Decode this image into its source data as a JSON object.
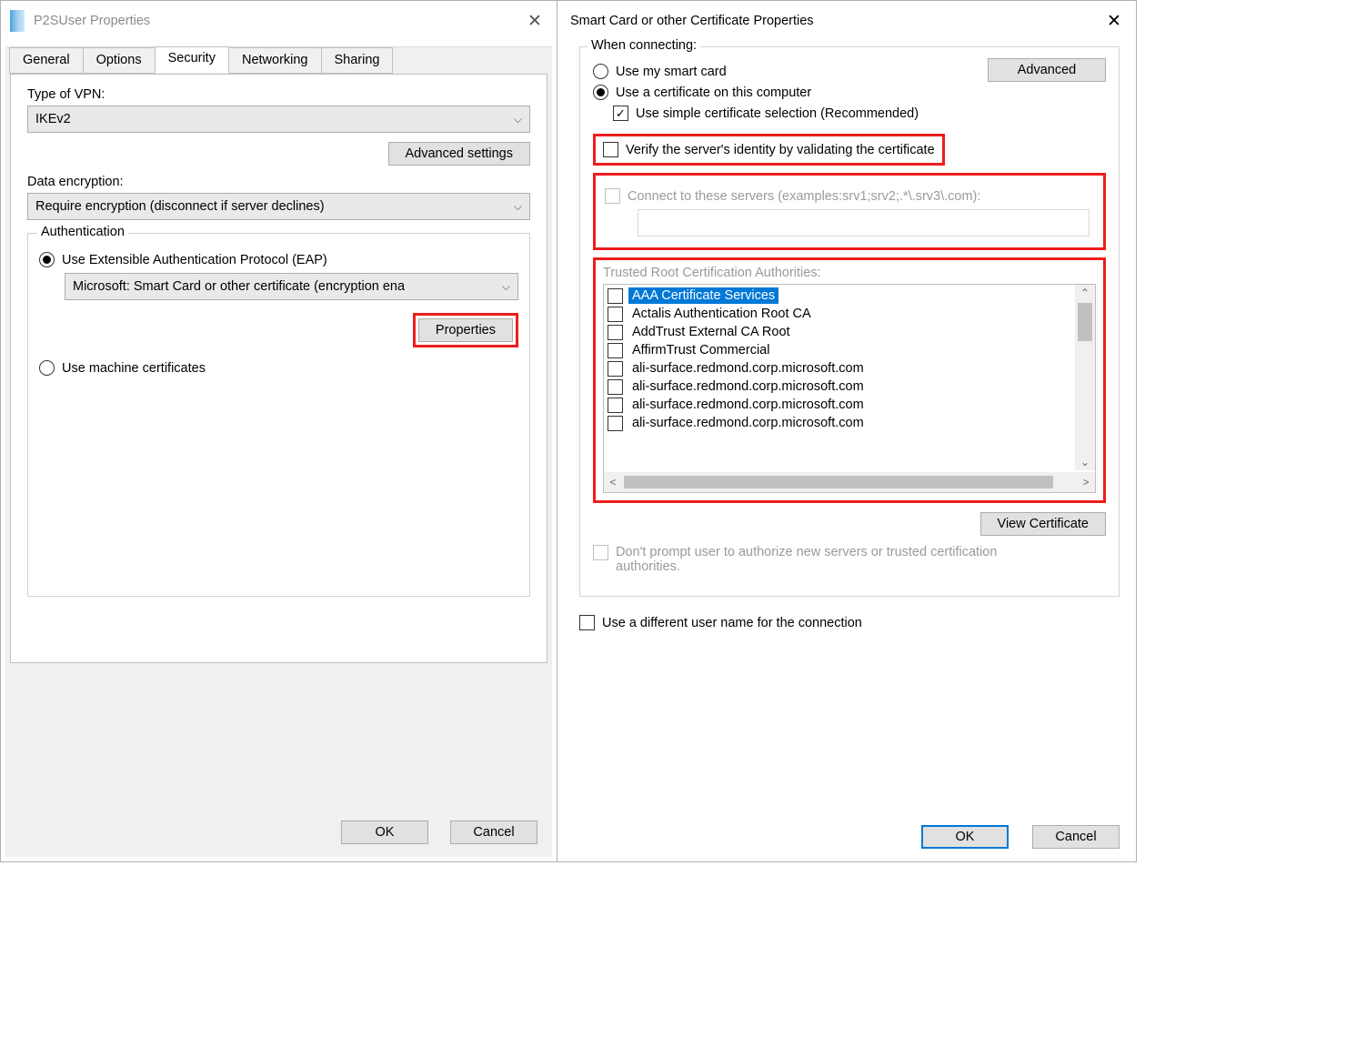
{
  "left": {
    "title": "P2SUser Properties",
    "tabs": [
      "General",
      "Options",
      "Security",
      "Networking",
      "Sharing"
    ],
    "active_tab": "Security",
    "type_label": "Type of VPN:",
    "type_value": "IKEv2",
    "advanced_settings": "Advanced settings",
    "encryption_label": "Data encryption:",
    "encryption_value": "Require encryption (disconnect if server declines)",
    "auth_legend": "Authentication",
    "radio_eap": "Use Extensible Authentication Protocol (EAP)",
    "eap_method": "Microsoft: Smart Card or other certificate (encryption ena",
    "properties_btn": "Properties",
    "radio_machine": "Use machine certificates",
    "ok": "OK",
    "cancel": "Cancel"
  },
  "right": {
    "title": "Smart Card or other Certificate Properties",
    "when_connecting": "When connecting:",
    "radio_smartcard": "Use my smart card",
    "radio_cert": "Use a certificate on this computer",
    "chk_simple": "Use simple certificate selection (Recommended)",
    "advanced": "Advanced",
    "chk_verify": "Verify the server's identity by validating the certificate",
    "chk_connect_servers": "Connect to these servers (examples:srv1;srv2;.*\\.srv3\\.com):",
    "servers_value": "",
    "trusted_label": "Trusted Root Certification Authorities:",
    "ca_items": [
      "AAA Certificate Services",
      "Actalis Authentication Root CA",
      "AddTrust External CA Root",
      "AffirmTrust Commercial",
      "ali-surface.redmond.corp.microsoft.com",
      "ali-surface.redmond.corp.microsoft.com",
      "ali-surface.redmond.corp.microsoft.com",
      "ali-surface.redmond.corp.microsoft.com"
    ],
    "view_cert": "View Certificate",
    "dont_prompt": "Don't prompt user to authorize new servers or trusted certification authorities.",
    "chk_diff_user": "Use a different user name for the connection",
    "ok": "OK",
    "cancel": "Cancel"
  }
}
